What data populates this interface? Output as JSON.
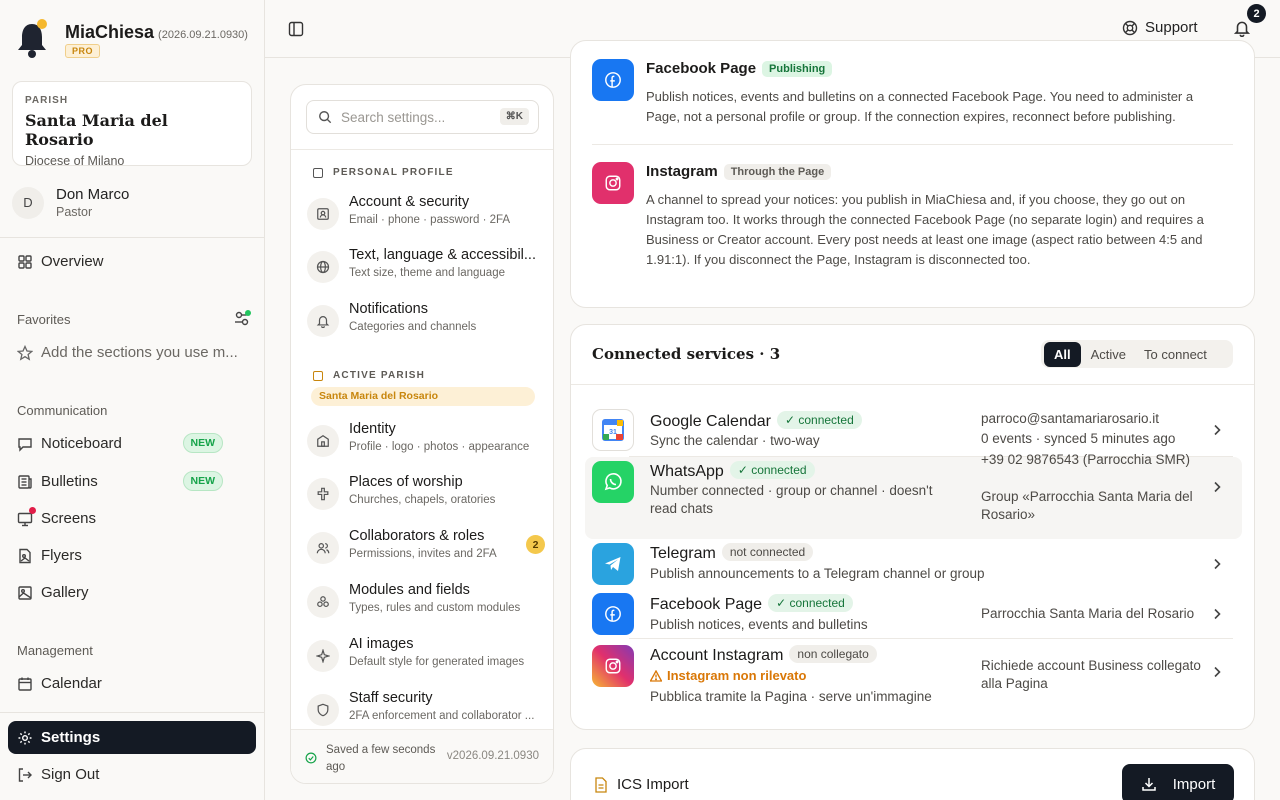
{
  "brand": {
    "name": "MiaChiesa",
    "version": "(2026.09.21.0930)",
    "badge": "PRO"
  },
  "parish_card": {
    "kicker": "PARISH",
    "name": "Santa Maria del Rosario",
    "diocese": "Diocese of Milano"
  },
  "user": {
    "initial": "D",
    "name": "Don Marco",
    "role": "Pastor"
  },
  "sidebar": {
    "overview": "Overview",
    "favorites_label": "Favorites",
    "favorites_hint": "Add the sections you use m...",
    "communication_label": "Communication",
    "communication": [
      {
        "label": "Noticeboard",
        "badge": "NEW"
      },
      {
        "label": "Bulletins",
        "badge": "NEW"
      },
      {
        "label": "Screens"
      },
      {
        "label": "Flyers"
      },
      {
        "label": "Gallery"
      }
    ],
    "management_label": "Management",
    "calendar": "Calendar",
    "settings": "Settings",
    "signout": "Sign Out"
  },
  "topbar": {
    "support": "Support",
    "notifications_count": "2"
  },
  "settings_panel": {
    "search_placeholder": "Search settings...",
    "search_shortcut": "⌘K",
    "personal_label": "PERSONAL PROFILE",
    "personal": [
      {
        "title": "Account & security",
        "sub": "Email · phone · password · 2FA"
      },
      {
        "title": "Text, language & accessibil...",
        "sub": "Text size, theme and language"
      },
      {
        "title": "Notifications",
        "sub": "Categories and channels"
      }
    ],
    "parish_label": "ACTIVE PARISH",
    "parish_pill": "Santa Maria del Rosario",
    "parish": [
      {
        "title": "Identity",
        "sub": "Profile · logo · photos · appearance"
      },
      {
        "title": "Places of worship",
        "sub": "Churches, chapels, oratories"
      },
      {
        "title": "Collaborators & roles",
        "sub": "Permissions, invites and 2FA",
        "count": "2"
      },
      {
        "title": "Modules and fields",
        "sub": "Types, rules and custom modules"
      },
      {
        "title": "AI images",
        "sub": "Default style for generated images"
      },
      {
        "title": "Staff security",
        "sub": "2FA enforcement and collaborator ..."
      }
    ],
    "saved_line1": "Saved a few seconds",
    "saved_line2": "ago",
    "version": "v2026.09.21.0930"
  },
  "channels": [
    {
      "title": "Facebook Page",
      "tag": "Publishing",
      "desc": "Publish notices, events and bulletins on a connected Facebook Page. You need to administer a Page, not a personal profile or group. If the connection expires, reconnect before publishing."
    },
    {
      "title": "Instagram",
      "tag": "Through the Page",
      "desc": "A channel to spread your notices: you publish in MiaChiesa and, if you choose, they go out on Instagram too. It works through the connected Facebook Page (no separate login) and requires a Business or Creator account. Every post needs at least one image (aspect ratio between 4:5 and 1.91:1). If you disconnect the Page, Instagram is disconnected too."
    }
  ],
  "connected": {
    "title": "Connected services · 3",
    "filters": [
      "All",
      "Active",
      "To connect"
    ],
    "services": [
      {
        "name": "Google Calendar",
        "status": "connected",
        "sub": "Sync the calendar · two-way",
        "right1": "parroco@santamariarosario.it",
        "right2": "0 events · synced 5 minutes ago"
      },
      {
        "name": "WhatsApp",
        "status": "connected",
        "sub": "Number connected · group or channel · doesn't read chats",
        "right1": "+39 02 9876543 (Parrocchia SMR)",
        "right2": "Group «Parrocchia Santa Maria del Rosario»"
      },
      {
        "name": "Telegram",
        "status": "not connected",
        "sub": "Publish announcements to a Telegram channel or group"
      },
      {
        "name": "Facebook Page",
        "status": "connected",
        "sub": "Publish notices, events and bulletins",
        "right1": "Parrocchia Santa Maria del Rosario"
      },
      {
        "name": "Account Instagram",
        "status": "non collegato",
        "warning": "Instagram non rilevato",
        "sub": "Pubblica tramite la Pagina · serve un'immagine",
        "right1": "Richiede account Business collegato alla Pagina"
      }
    ]
  },
  "ics": {
    "title": "ICS Import",
    "button": "Import"
  },
  "colors": {
    "accent_dark": "#141a24",
    "success": "#16a34a",
    "warning": "#d97706",
    "facebook": "#1877f2",
    "whatsapp": "#25d366",
    "telegram": "#2aa3df",
    "instagram": "#e1306c",
    "pro_gold": "#c8860d"
  }
}
